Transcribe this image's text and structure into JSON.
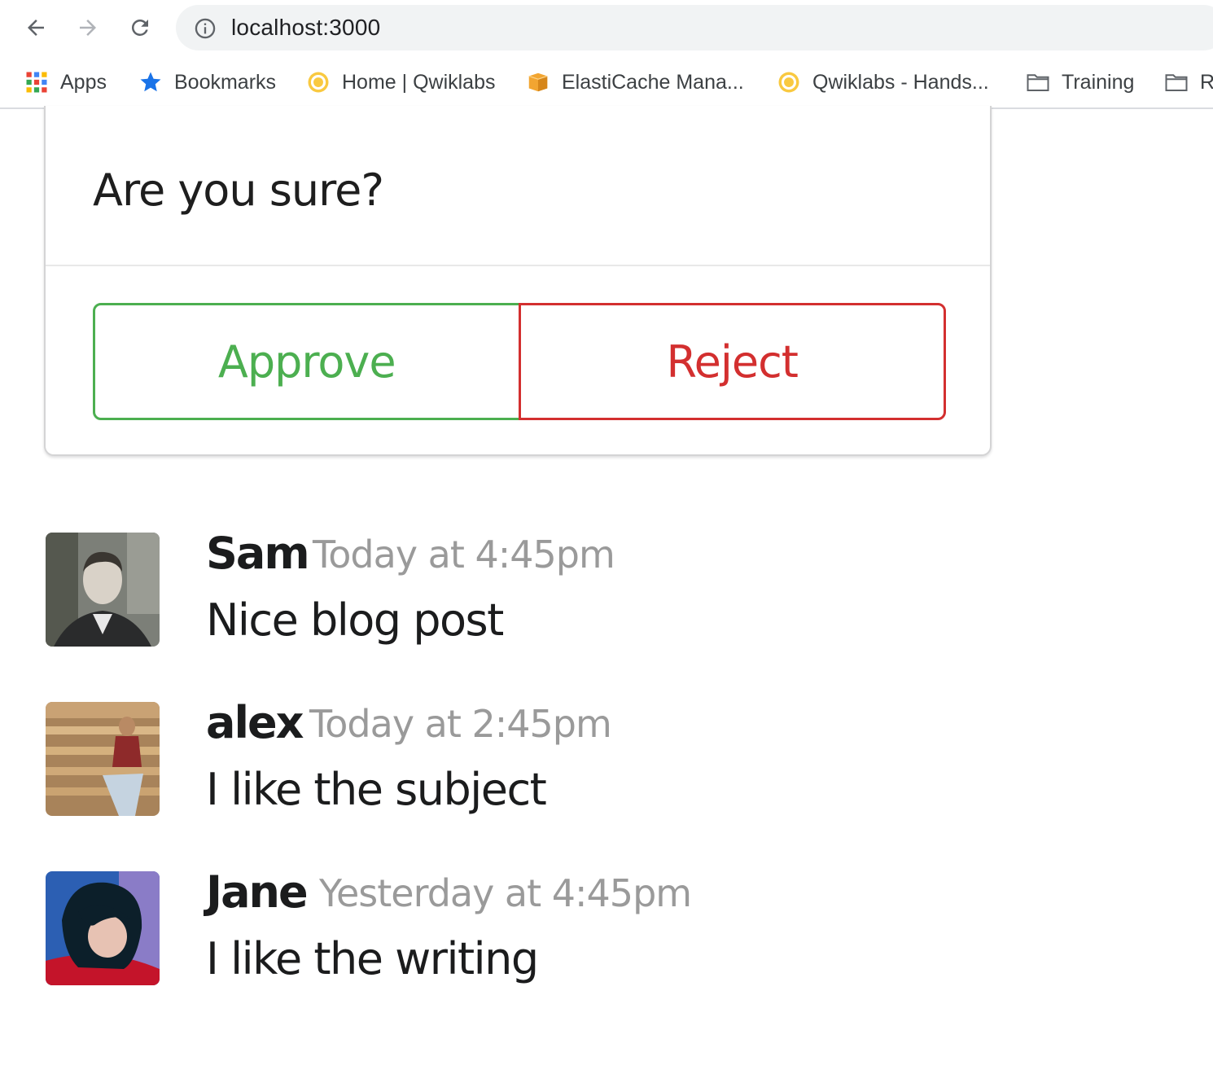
{
  "browser": {
    "url": "localhost:3000"
  },
  "bookmarks": [
    {
      "label": "Apps",
      "icon": "apps-grid-icon"
    },
    {
      "label": "Bookmarks",
      "icon": "star-icon"
    },
    {
      "label": "Home | Qwiklabs",
      "icon": "qwiklabs-icon"
    },
    {
      "label": "ElastiCache Mana...",
      "icon": "aws-box-icon"
    },
    {
      "label": "Qwiklabs - Hands...",
      "icon": "qwiklabs-icon"
    },
    {
      "label": "Training",
      "icon": "folder-icon"
    },
    {
      "label": "R",
      "icon": "folder-icon"
    }
  ],
  "dialog": {
    "title": "Are you sure?",
    "approve_label": "Approve",
    "reject_label": "Reject",
    "colors": {
      "approve": "#4caf50",
      "reject": "#d32f2f"
    }
  },
  "comments": [
    {
      "author": "Sam",
      "meta": "Today at 4:45pm",
      "text": "Nice blog post"
    },
    {
      "author": "alex",
      "meta": "Today at 2:45pm",
      "text": "I like the subject"
    },
    {
      "author": "Jane",
      "meta": "Yesterday at 4:45pm",
      "text": "I like the writing"
    }
  ]
}
